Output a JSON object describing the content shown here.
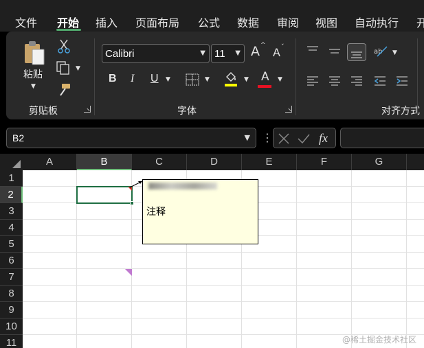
{
  "tabs": [
    "文件",
    "开始",
    "插入",
    "页面布局",
    "公式",
    "数据",
    "审阅",
    "视图",
    "自动执行",
    "开"
  ],
  "active_tab": "开始",
  "clipboard": {
    "paste_label": "粘贴",
    "group_label": "剪贴板",
    "icons": [
      "paste-icon",
      "cut-icon",
      "copy-icon",
      "format-painter-icon"
    ]
  },
  "font": {
    "name": "Calibri",
    "size": "11",
    "group_label": "字体",
    "increase_label": "A",
    "decrease_label": "A",
    "bold": "B",
    "italic": "I",
    "underline": "U",
    "font_color_label": "A",
    "fill_color": "#ffff00",
    "font_color": "#e81123"
  },
  "alignment": {
    "group_label": "对齐方式"
  },
  "formula_bar": {
    "name_box": "B2",
    "fx_label": "fx",
    "more": "⋮"
  },
  "grid": {
    "columns": [
      "A",
      "B",
      "C",
      "D",
      "E",
      "F",
      "G"
    ],
    "rows": [
      "1",
      "2",
      "3",
      "4",
      "5",
      "6",
      "7",
      "8",
      "9",
      "10",
      "11"
    ],
    "selected_cell": "B2",
    "comment_text": "注释"
  },
  "watermark": "@稀土掘金技术社区",
  "colors": {
    "accent_green": "#1e6e42",
    "tab_underline": "#4fa46a",
    "comment_bg": "#ffffe1",
    "comment_indicator": "#c0392b"
  }
}
